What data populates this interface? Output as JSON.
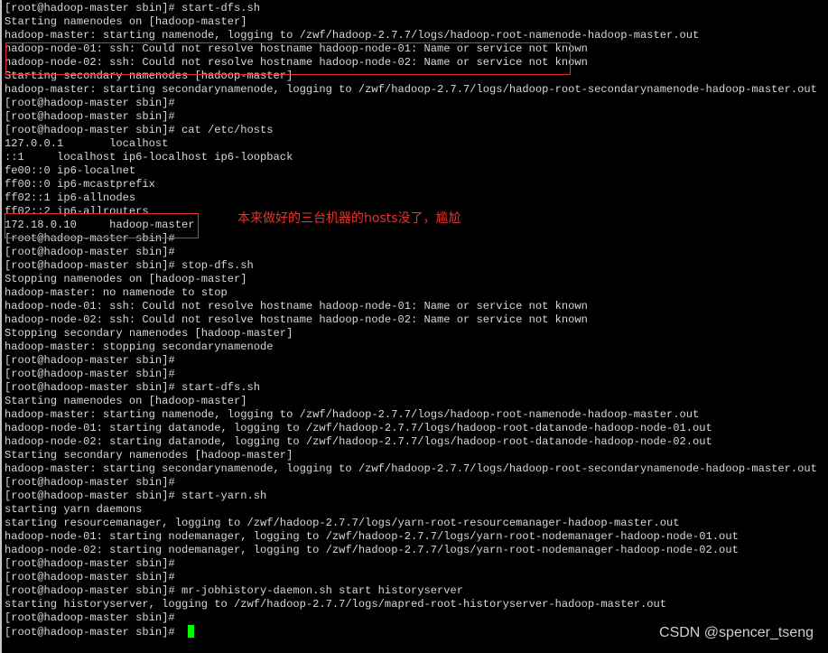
{
  "terminal": {
    "lines": [
      "[root@hadoop-master sbin]# start-dfs.sh",
      "Starting namenodes on [hadoop-master]",
      "hadoop-master: starting namenode, logging to /zwf/hadoop-2.7.7/logs/hadoop-root-namenode-hadoop-master.out",
      "hadoop-node-01: ssh: Could not resolve hostname hadoop-node-01: Name or service not known",
      "hadoop-node-02: ssh: Could not resolve hostname hadoop-node-02: Name or service not known",
      "Starting secondary namenodes [hadoop-master]",
      "hadoop-master: starting secondarynamenode, logging to /zwf/hadoop-2.7.7/logs/hadoop-root-secondarynamenode-hadoop-master.out",
      "[root@hadoop-master sbin]#",
      "[root@hadoop-master sbin]#",
      "[root@hadoop-master sbin]# cat /etc/hosts",
      "127.0.0.1       localhost",
      "::1     localhost ip6-localhost ip6-loopback",
      "fe00::0 ip6-localnet",
      "ff00::0 ip6-mcastprefix",
      "ff02::1 ip6-allnodes",
      "ff02::2 ip6-allrouters",
      "172.18.0.10     hadoop-master",
      "[root@hadoop-master sbin]#",
      "[root@hadoop-master sbin]#",
      "[root@hadoop-master sbin]# stop-dfs.sh",
      "Stopping namenodes on [hadoop-master]",
      "hadoop-master: no namenode to stop",
      "hadoop-node-01: ssh: Could not resolve hostname hadoop-node-01: Name or service not known",
      "hadoop-node-02: ssh: Could not resolve hostname hadoop-node-02: Name or service not known",
      "Stopping secondary namenodes [hadoop-master]",
      "hadoop-master: stopping secondarynamenode",
      "[root@hadoop-master sbin]#",
      "[root@hadoop-master sbin]#",
      "[root@hadoop-master sbin]# start-dfs.sh",
      "Starting namenodes on [hadoop-master]",
      "hadoop-master: starting namenode, logging to /zwf/hadoop-2.7.7/logs/hadoop-root-namenode-hadoop-master.out",
      "hadoop-node-01: starting datanode, logging to /zwf/hadoop-2.7.7/logs/hadoop-root-datanode-hadoop-node-01.out",
      "hadoop-node-02: starting datanode, logging to /zwf/hadoop-2.7.7/logs/hadoop-root-datanode-hadoop-node-02.out",
      "Starting secondary namenodes [hadoop-master]",
      "hadoop-master: starting secondarynamenode, logging to /zwf/hadoop-2.7.7/logs/hadoop-root-secondarynamenode-hadoop-master.out",
      "[root@hadoop-master sbin]#",
      "[root@hadoop-master sbin]# start-yarn.sh",
      "starting yarn daemons",
      "starting resourcemanager, logging to /zwf/hadoop-2.7.7/logs/yarn-root-resourcemanager-hadoop-master.out",
      "hadoop-node-01: starting nodemanager, logging to /zwf/hadoop-2.7.7/logs/yarn-root-nodemanager-hadoop-node-01.out",
      "hadoop-node-02: starting nodemanager, logging to /zwf/hadoop-2.7.7/logs/yarn-root-nodemanager-hadoop-node-02.out",
      "[root@hadoop-master sbin]#",
      "[root@hadoop-master sbin]#",
      "[root@hadoop-master sbin]# mr-jobhistory-daemon.sh start historyserver",
      "starting historyserver, logging to /zwf/hadoop-2.7.7/logs/mapred-root-historyserver-hadoop-master.out",
      "[root@hadoop-master sbin]#",
      "[root@hadoop-master sbin]# "
    ],
    "cursor_color": "#00ff00",
    "text_color": "#d8d8d8",
    "background": "#000000"
  },
  "annotation": {
    "text": "本来做好的三台机器的hosts没了，尴尬",
    "color": "#e8322e"
  },
  "highlight_color": "#e03030",
  "watermark": "CSDN @spencer_tseng"
}
